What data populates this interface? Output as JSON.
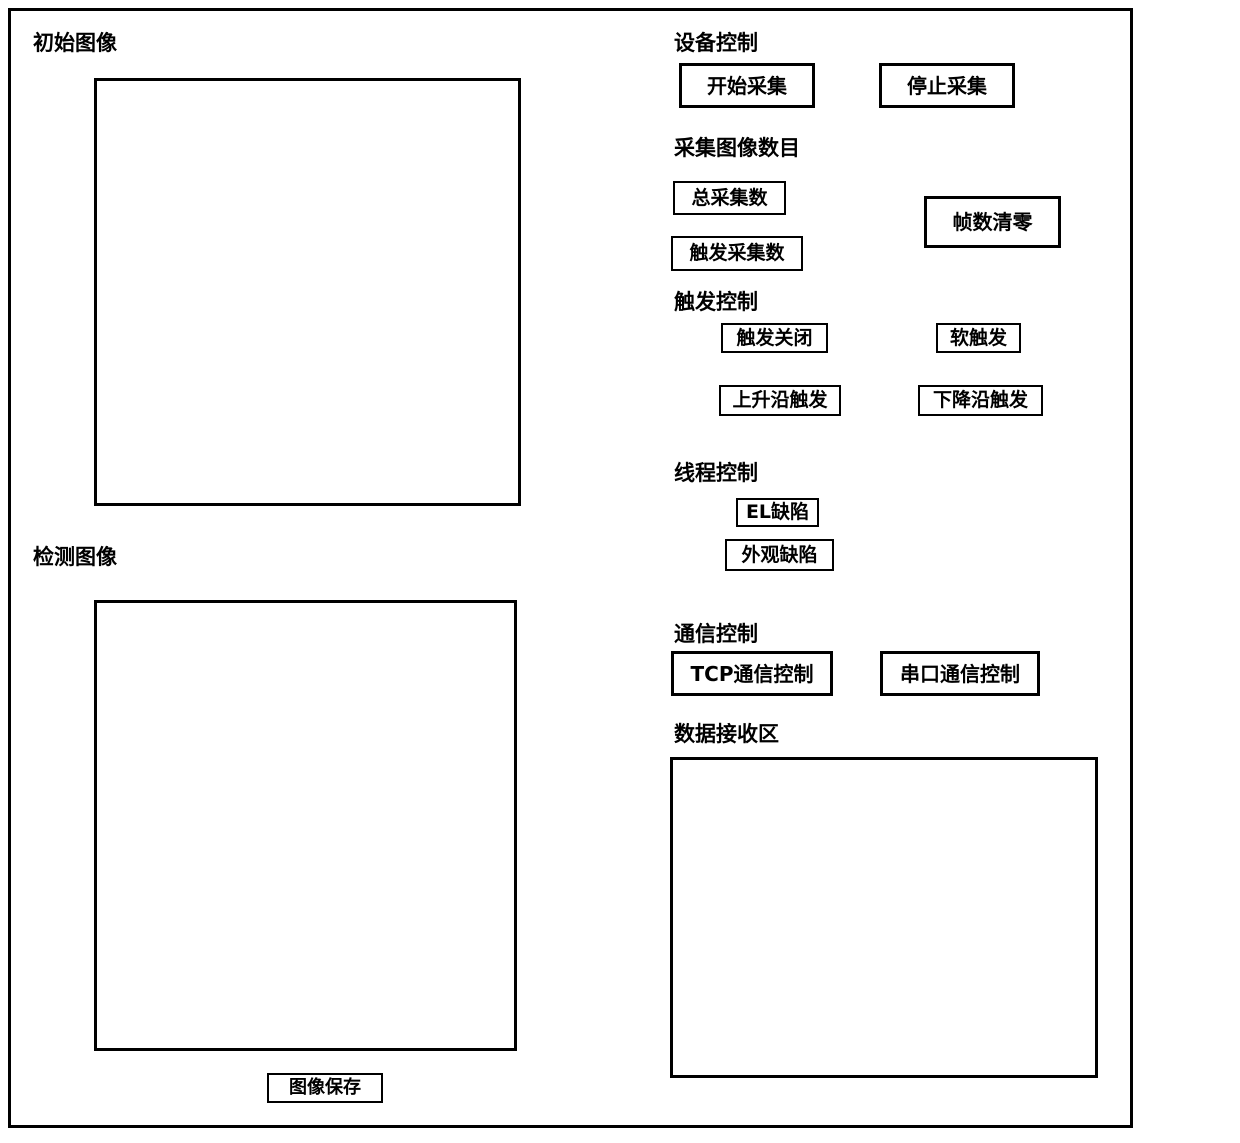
{
  "window": {
    "title": "",
    "background_color": "#ffffff",
    "border_color": "#000000"
  },
  "left_panel": {
    "initial_image": {
      "label": "初始图像",
      "canvas_placeholder": ""
    },
    "detect_image": {
      "label": "检测图像",
      "canvas_placeholder": ""
    },
    "save_button": {
      "label": "图像保存"
    }
  },
  "right_panel": {
    "device_control": {
      "label": "设备控制",
      "buttons": [
        {
          "label": "开始采集"
        },
        {
          "label": "停止采集"
        }
      ]
    },
    "capture_count": {
      "label": "采集图像数目",
      "buttons": [
        {
          "label": "总采集数"
        },
        {
          "label": "触发采集数"
        },
        {
          "label": "帧数清零"
        }
      ]
    },
    "trigger_control": {
      "label": "触发控制",
      "buttons": [
        {
          "label": "触发关闭"
        },
        {
          "label": "软触发"
        },
        {
          "label": "上升沿触发"
        },
        {
          "label": "下降沿触发"
        }
      ]
    },
    "thread_control": {
      "label": "线程控制",
      "buttons": [
        {
          "label": "EL缺陷"
        },
        {
          "label": "外观缺陷"
        }
      ]
    },
    "communication_control": {
      "label": "通信控制",
      "buttons": [
        {
          "label": "TCP通信控制"
        },
        {
          "label": "串口通信控制"
        }
      ]
    },
    "data_receive": {
      "label": "数据接收区",
      "content": ""
    }
  }
}
